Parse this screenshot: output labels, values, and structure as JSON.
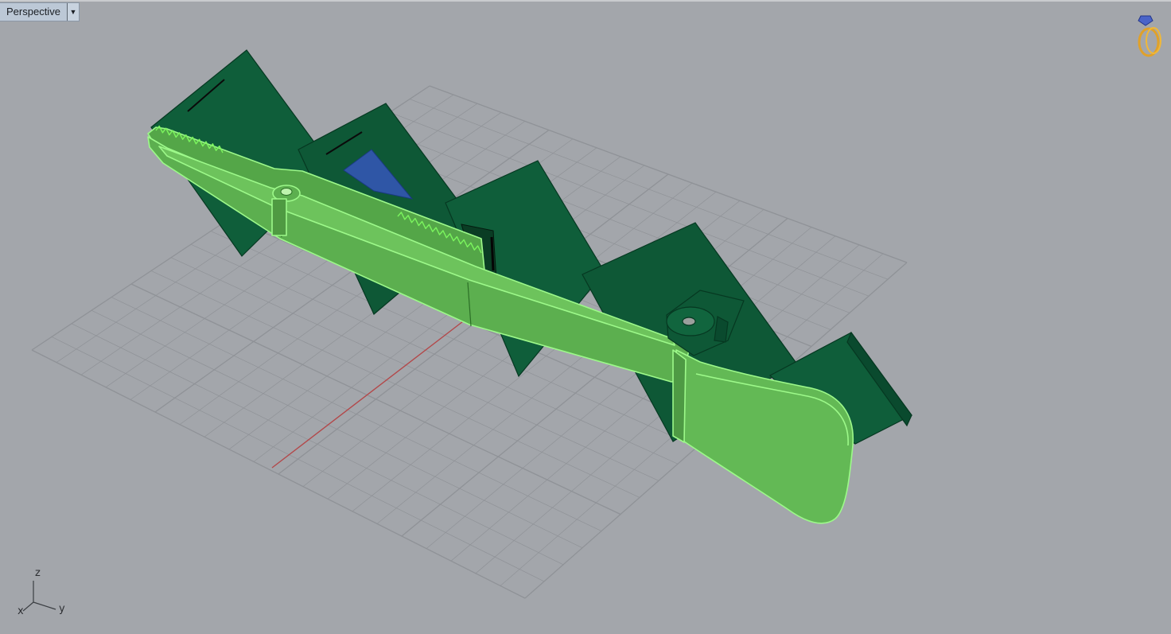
{
  "viewport": {
    "name": "Perspective",
    "menu_icon": "chevron-down-icon",
    "background": "#a3a6ab",
    "grid_color": "#8e9196",
    "selection_color": "#7bf55e",
    "object_color": "#0f5e3a"
  },
  "corner_icon": "ring-gem-icon",
  "axes": {
    "x": "x",
    "y": "y",
    "z": "z"
  }
}
